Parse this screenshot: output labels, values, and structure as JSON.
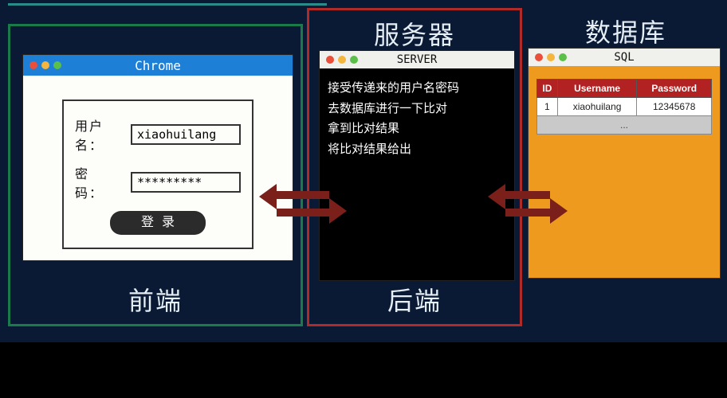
{
  "titles": {
    "frontend": "前端",
    "server": "服务器",
    "backend": "后端",
    "database": "数据库"
  },
  "chrome": {
    "title": "Chrome",
    "username_label": "用户名：",
    "username_value": "xiaohuilang",
    "password_label": "密　码：",
    "password_value": "*********",
    "login_button": "登录"
  },
  "server": {
    "title": "SERVER",
    "lines": [
      "接受传递来的用户名密码",
      "去数据库进行一下比对",
      "拿到比对结果",
      "将比对结果给出"
    ]
  },
  "sql": {
    "title": "SQL",
    "columns": [
      "ID",
      "Username",
      "Password"
    ],
    "rows": [
      [
        "1",
        "xiaohuilang",
        "12345678"
      ]
    ],
    "more": "..."
  }
}
